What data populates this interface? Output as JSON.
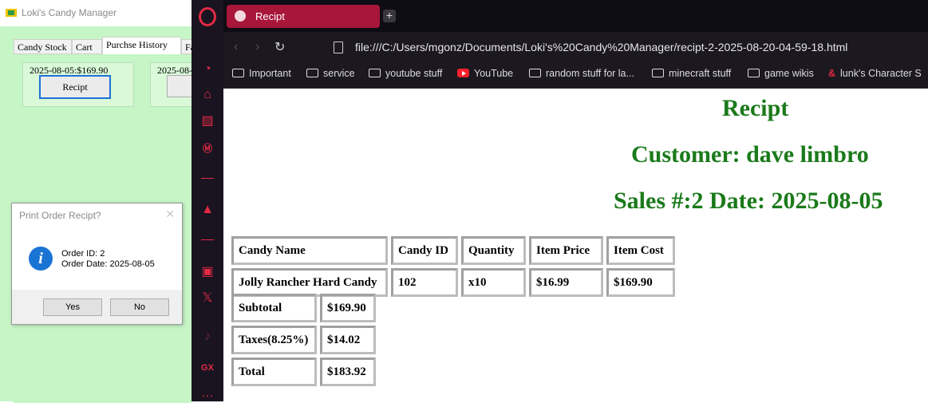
{
  "app": {
    "title": "Loki's Candy Manager",
    "tabs": [
      "Candy Stock",
      "Cart",
      "Purchse History",
      "Fa"
    ],
    "orders": [
      {
        "title": "2025-08-05:$169.90",
        "button": "Recipt"
      },
      {
        "title": "2025-08-",
        "button": "R"
      }
    ]
  },
  "dialog": {
    "title": "Print Order Recipt?",
    "line1": "Order ID: 2",
    "line2": "Order Date: 2025-08-05",
    "yes": "Yes",
    "no": "No"
  },
  "browser": {
    "tab_title": "Recipt",
    "url": "file:///C:/Users/mgonz/Documents/Loki's%20Candy%20Manager/recipt-2-2025-08-20-04-59-18.html",
    "bookmarks": [
      "Important",
      "service",
      "youtube stuff",
      "YouTube",
      "random stuff for la...",
      "minecraft stuff",
      "game wikis",
      "lunk's Character S"
    ]
  },
  "receipt": {
    "heading": "Recipt",
    "customer": "Customer: dave limbro",
    "sales": "Sales #:2 Date: 2025-08-05",
    "headers": [
      "Candy Name",
      "Candy ID",
      "Quantity",
      "Item Price",
      "Item Cost"
    ],
    "row": [
      "Jolly Rancher Hard Candy",
      "102",
      "x10",
      "$16.99",
      "$169.90"
    ],
    "subtotal_label": "Subtotal",
    "subtotal": "$169.90",
    "tax_label": "Taxes(8.25%)",
    "tax": "$14.02",
    "total_label": "Total",
    "total": "$183.92"
  }
}
